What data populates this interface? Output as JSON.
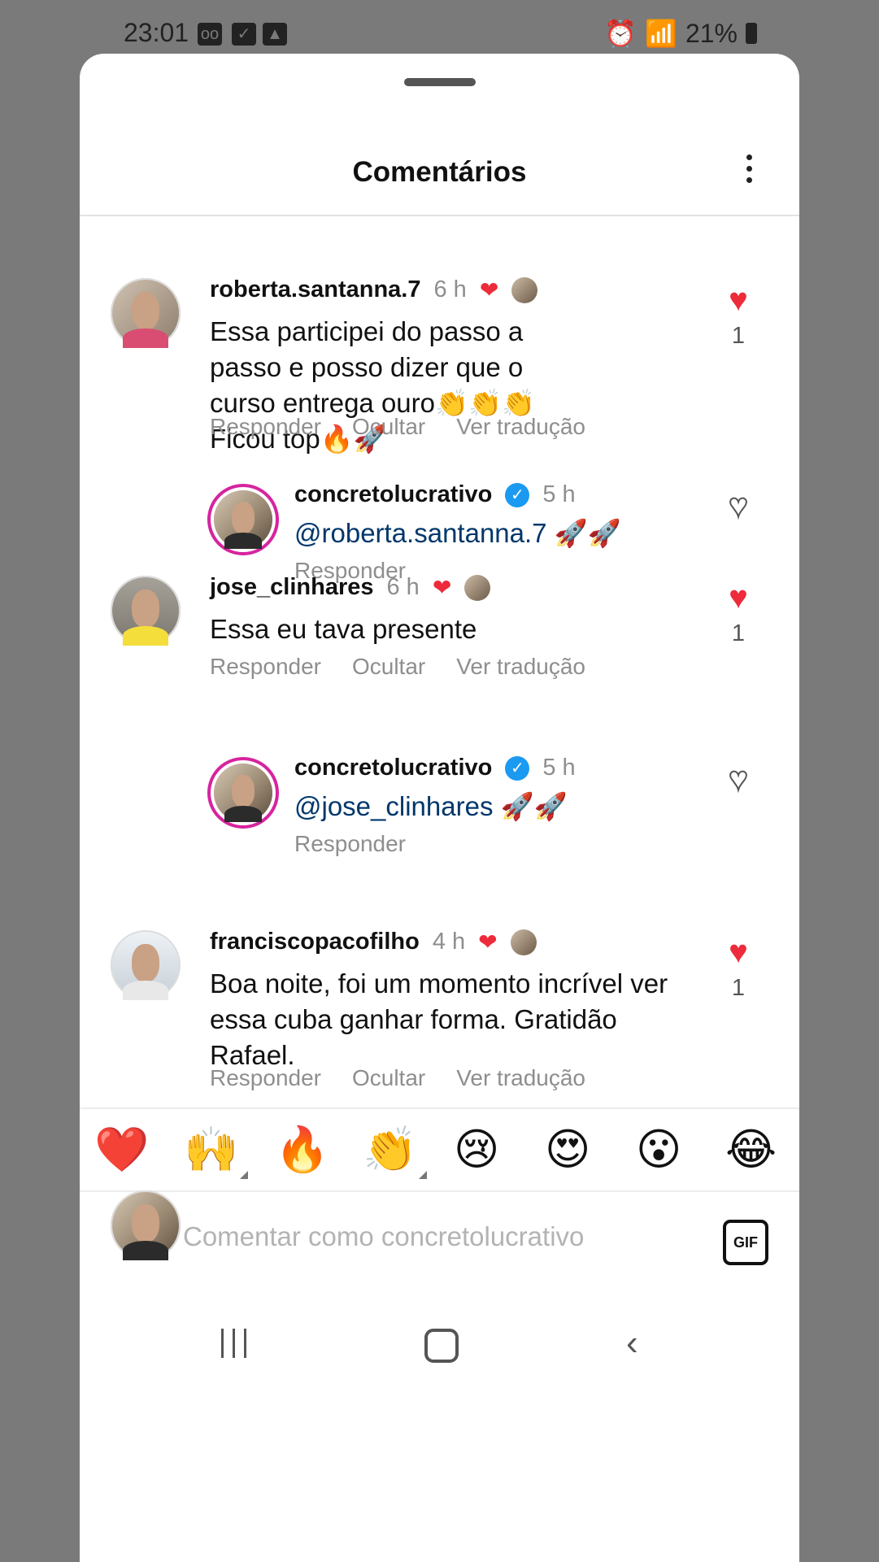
{
  "status_bar": {
    "time": "23:01",
    "battery": "21%",
    "icons": [
      "voicemail-icon",
      "checkbox-icon",
      "image-icon",
      "alarm-icon",
      "wifi-icon",
      "signal-icon",
      "battery-icon"
    ]
  },
  "header": {
    "title": "Comentários"
  },
  "comments": [
    {
      "username": "roberta.santanna.7",
      "time": "6 h",
      "text": "Essa participei do passo a passo e posso dizer que o curso entrega ouro👏👏👏 Ficou top🔥🚀",
      "likes": "1",
      "actions": [
        "Responder",
        "Ocultar",
        "Ver tradução"
      ],
      "reply": {
        "username": "concretolucrativo",
        "time": "5 h",
        "mention": "@roberta.santanna.7",
        "text": " 🚀🚀",
        "action": "Responder"
      }
    },
    {
      "username": "jose_clinhares",
      "time": "6 h",
      "text": "Essa eu tava presente",
      "likes": "1",
      "actions": [
        "Responder",
        "Ocultar",
        "Ver tradução"
      ],
      "reply": {
        "username": "concretolucrativo",
        "time": "5 h",
        "mention": "@jose_clinhares",
        "text": " 🚀🚀",
        "action": "Responder"
      }
    },
    {
      "username": "franciscopacofilho",
      "time": "4 h",
      "text": "Boa noite, foi um momento incrível ver essa cuba ganhar forma. Gratidão Rafael.",
      "likes": "1",
      "actions": [
        "Responder",
        "Ocultar",
        "Ver tradução"
      ]
    }
  ],
  "emoji_bar": [
    "❤️",
    "🙌",
    "🔥",
    "👏",
    "😢",
    "😍",
    "😮",
    "😂"
  ],
  "composer": {
    "placeholder": "Comentar como concretolucrativo",
    "gif_label": "GIF"
  },
  "colors": {
    "like_red": "#ed2b3a",
    "mention_blue": "#00376b",
    "verified_blue": "#1a9af1",
    "muted_gray": "#8e8e8e"
  }
}
